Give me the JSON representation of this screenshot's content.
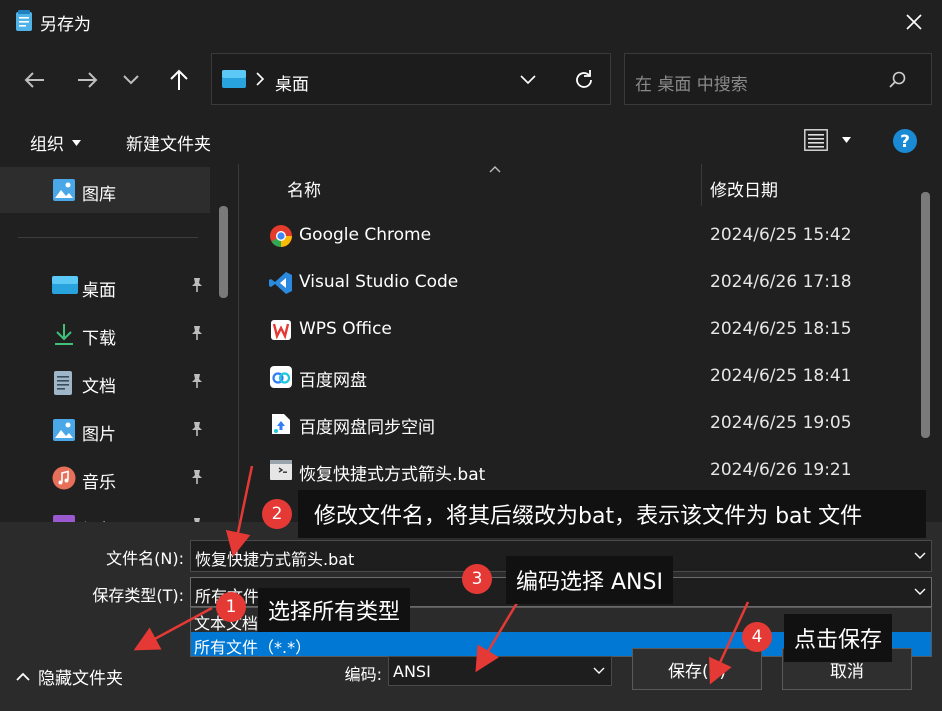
{
  "window": {
    "title": "另存为"
  },
  "address": {
    "current": "桌面"
  },
  "search": {
    "placeholder": "在 桌面 中搜索"
  },
  "toolbar": {
    "organize": "组织",
    "new_folder": "新建文件夹"
  },
  "sidebar": {
    "items": [
      {
        "label": "图库",
        "icon": "gallery-icon"
      },
      {
        "label": "桌面",
        "icon": "desktop-icon",
        "pinned": true
      },
      {
        "label": "下载",
        "icon": "download-icon",
        "pinned": true
      },
      {
        "label": "文档",
        "icon": "document-icon",
        "pinned": true
      },
      {
        "label": "图片",
        "icon": "pictures-icon",
        "pinned": true
      },
      {
        "label": "音乐",
        "icon": "music-icon",
        "pinned": true
      },
      {
        "label": "视频",
        "icon": "video-icon",
        "pinned": true
      }
    ]
  },
  "file_list": {
    "headers": {
      "name": "名称",
      "modified": "修改日期"
    },
    "rows": [
      {
        "name": "Google Chrome",
        "modified": "2024/6/25 15:42",
        "icon": "chrome-icon"
      },
      {
        "name": "Visual Studio Code",
        "modified": "2024/6/26 17:18",
        "icon": "vscode-icon"
      },
      {
        "name": "WPS Office",
        "modified": "2024/6/25 18:15",
        "icon": "wps-icon"
      },
      {
        "name": "百度网盘",
        "modified": "2024/6/25 18:41",
        "icon": "baidu-netdisk-icon"
      },
      {
        "name": "百度网盘同步空间",
        "modified": "2024/6/25 19:05",
        "icon": "baidu-sync-icon"
      },
      {
        "name": "恢复快捷式方式箭头.bat",
        "modified": "2024/6/26 19:21",
        "icon": "bat-file-icon"
      }
    ]
  },
  "form": {
    "filename_label": "文件名(N):",
    "filename_value": "恢复快捷方式箭头.bat",
    "filetype_label": "保存类型(T):",
    "filetype_value": "所有文件（*.*）",
    "filetype_options": [
      "文本文档(*.txt)",
      "所有文件（*.*）"
    ],
    "encoding_label": "编码:",
    "encoding_value": "ANSI",
    "hide_folders": "隐藏文件夹",
    "save_button": "保存(S)",
    "cancel_button": "取消"
  },
  "annotations": [
    {
      "number": "1",
      "text": "选择所有类型"
    },
    {
      "number": "2",
      "text": "修改文件名，将其后缀改为bat，表示该文件为 bat 文件"
    },
    {
      "number": "3",
      "text": "编码选择 ANSI"
    },
    {
      "number": "4",
      "text": "点击保存"
    }
  ],
  "colors": {
    "accent": "#0078d4",
    "annotation_badge": "#e53935",
    "arrow": "#e53935",
    "help": "#1a8ad4"
  }
}
